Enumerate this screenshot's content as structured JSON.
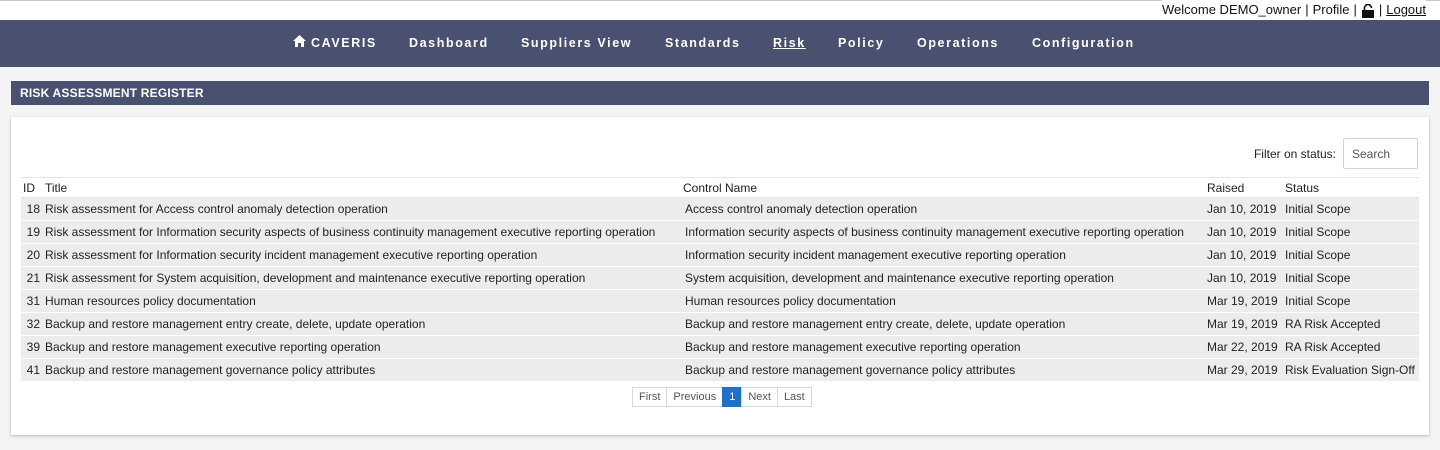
{
  "userbar": {
    "welcome": "Welcome DEMO_owner",
    "sep1": "|",
    "profile": "Profile",
    "sep2": "|",
    "sep3": "|",
    "logout": "Logout"
  },
  "nav": {
    "brand": "CAVERIS",
    "items": [
      "Dashboard",
      "Suppliers View",
      "Standards",
      "Risk",
      "Policy",
      "Operations",
      "Configuration"
    ],
    "active": "Risk"
  },
  "section_title": "RISK ASSESSMENT REGISTER",
  "filter": {
    "label": "Filter on status:",
    "placeholder": "Search"
  },
  "table": {
    "columns": [
      "ID",
      "Title",
      "Control Name",
      "Raised",
      "Status"
    ],
    "rows": [
      [
        "18",
        "Risk assessment for Access control anomaly detection operation",
        "Access control anomaly detection operation",
        "Jan 10, 2019",
        "Initial Scope"
      ],
      [
        "19",
        "Risk assessment for Information security aspects of business continuity management executive reporting operation",
        "Information security aspects of business continuity management executive reporting operation",
        "Jan 10, 2019",
        "Initial Scope"
      ],
      [
        "20",
        "Risk assessment for Information security incident management executive reporting operation",
        "Information security incident management executive reporting operation",
        "Jan 10, 2019",
        "Initial Scope"
      ],
      [
        "21",
        "Risk assessment for System acquisition, development and maintenance executive reporting operation",
        "System acquisition, development and maintenance executive reporting operation",
        "Jan 10, 2019",
        "Initial Scope"
      ],
      [
        "31",
        "Human resources policy documentation",
        "Human resources policy documentation",
        "Mar 19, 2019",
        "Initial Scope"
      ],
      [
        "32",
        "Backup and restore management entry create, delete, update operation",
        "Backup and restore management entry create, delete, update operation",
        "Mar 19, 2019",
        "RA Risk Accepted"
      ],
      [
        "39",
        "Backup and restore management executive reporting operation",
        "Backup and restore management executive reporting operation",
        "Mar 22, 2019",
        "RA Risk Accepted"
      ],
      [
        "41",
        "Backup and restore management governance policy attributes",
        "Backup and restore management governance policy attributes",
        "Mar 29, 2019",
        "Risk Evaluation Sign-Off"
      ]
    ]
  },
  "pager": {
    "first": "First",
    "previous": "Previous",
    "current": "1",
    "next": "Next",
    "last": "Last"
  },
  "colors": {
    "nav_bg": "#4a5070",
    "pager_active": "#1a73c8",
    "row_bg": "#ececec"
  }
}
